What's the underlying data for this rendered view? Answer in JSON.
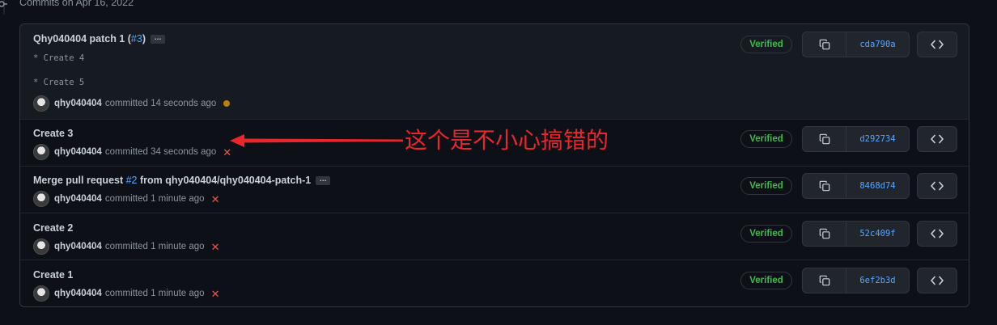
{
  "group_header": "Commits on Apr 16, 2022",
  "verified_label": "Verified",
  "committed_word": "committed",
  "ellipsis": "…",
  "annotation": "这个是不小心搞错的",
  "colors": {
    "accent": "#58a6ff",
    "verified": "#3fb950",
    "pending": "#bb8009",
    "failure": "#f85149",
    "annotation": "#e8262b"
  },
  "commits": [
    {
      "title": "Qhy040404 patch 1 (",
      "link": "#3",
      "title_suffix": ")",
      "desc1": "* Create 4",
      "desc2": "* Create 5",
      "author": "qhy040404",
      "time": "14 seconds ago",
      "status": "pending",
      "sha": "cda790a"
    },
    {
      "title": "Create 3",
      "author": "qhy040404",
      "time": "34 seconds ago",
      "status": "failure",
      "sha": "d292734"
    },
    {
      "title": "Merge pull request ",
      "link": "#2",
      "title_suffix": " from qhy040404/qhy040404-patch-1",
      "author": "qhy040404",
      "time": "1 minute ago",
      "status": "failure",
      "sha": "8468d74"
    },
    {
      "title": "Create 2",
      "author": "qhy040404",
      "time": "1 minute ago",
      "status": "failure",
      "sha": "52c409f"
    },
    {
      "title": "Create 1",
      "author": "qhy040404",
      "time": "1 minute ago",
      "status": "failure",
      "sha": "6ef2b3d"
    }
  ]
}
